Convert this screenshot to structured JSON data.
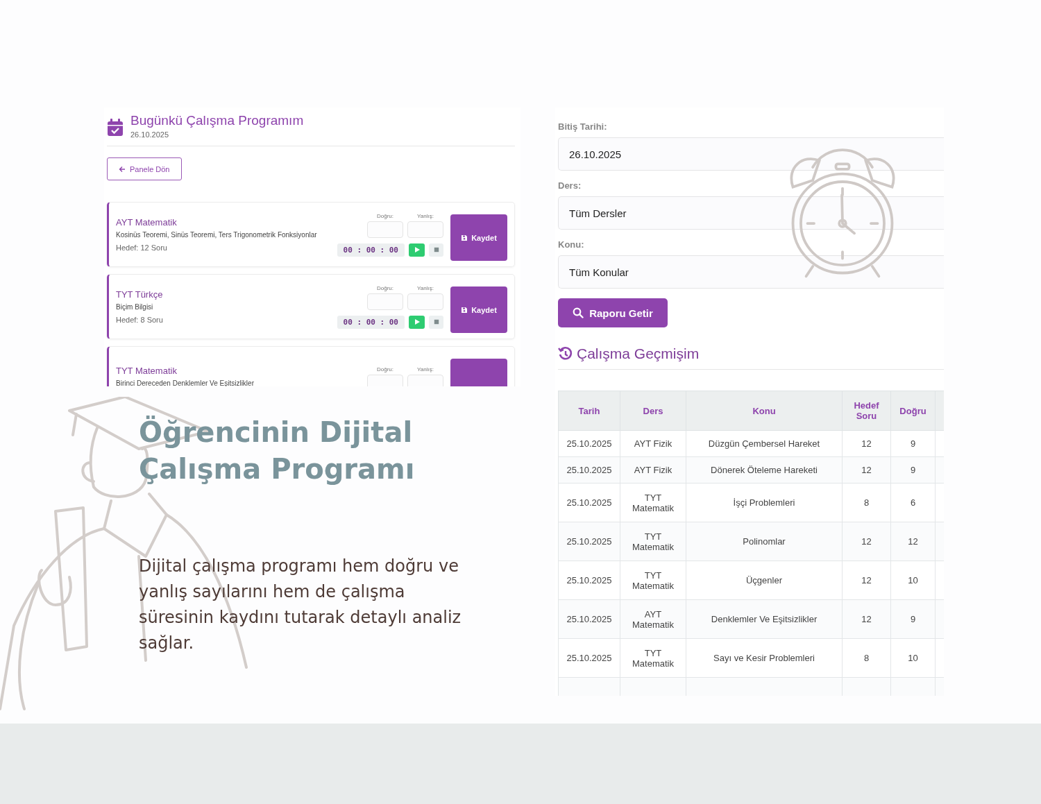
{
  "study_panel": {
    "title": "Bugünkü Çalışma Programım",
    "date": "26.10.2025",
    "back_button": "Panele Dön",
    "cards": [
      {
        "subject": "AYT Matematik",
        "topics": "Kosinüs Teoremi, Sinüs Teoremi, Ters Trigonometrik Fonksiyonlar",
        "target": "Hedef: 12 Soru",
        "correct_label": "Doğru:",
        "wrong_label": "Yanlış:",
        "timer": "00 : 00 : 00",
        "save_label": "Kaydet"
      },
      {
        "subject": "TYT Türkçe",
        "topics": "Biçim Bilgisi",
        "target": "Hedef: 8 Soru",
        "correct_label": "Doğru:",
        "wrong_label": "Yanlış:",
        "timer": "00 : 00 : 00",
        "save_label": "Kaydet"
      },
      {
        "subject": "TYT Matematik",
        "topics": "Birinci Dereceden Denklemler Ve Eşitsizlikler",
        "correct_label": "Doğru:",
        "wrong_label": "Yanlış:"
      }
    ]
  },
  "headline": {
    "title": "Öğrencinin Dijital Çalışma Programı",
    "description": "Dijital çalışma programı hem doğru ve yanlış sayılarını hem de çalışma süresinin kaydını tutarak detaylı analiz sağlar."
  },
  "report_panel": {
    "fields": [
      {
        "label": "Bitiş Tarihi:",
        "value": "26.10.2025"
      },
      {
        "label": "Ders:",
        "value": "Tüm Dersler"
      },
      {
        "label": "Konu:",
        "value": "Tüm Konular"
      }
    ],
    "report_button": "Raporu Getir",
    "history_title": "Çalışma Geçmişim",
    "table": {
      "columns": [
        "Tarih",
        "Ders",
        "Konu",
        "Hedef Soru",
        "Doğru"
      ],
      "rows": [
        [
          "25.10.2025",
          "AYT Fizik",
          "Düzgün Çembersel Hareket",
          "12",
          "9"
        ],
        [
          "25.10.2025",
          "AYT Fizik",
          "Dönerek Öteleme Hareketi",
          "12",
          "9"
        ],
        [
          "25.10.2025",
          "TYT Matematik",
          "İşçi Problemleri",
          "8",
          "6"
        ],
        [
          "25.10.2025",
          "TYT Matematik",
          "Polinomlar",
          "12",
          "12"
        ],
        [
          "25.10.2025",
          "TYT Matematik",
          "Üçgenler",
          "12",
          "10"
        ],
        [
          "25.10.2025",
          "AYT Matematik",
          "Denklemler Ve Eşitsizlikler",
          "12",
          "9"
        ],
        [
          "25.10.2025",
          "TYT Matematik",
          "Sayı ve Kesir Problemleri",
          "8",
          "10"
        ]
      ]
    }
  }
}
